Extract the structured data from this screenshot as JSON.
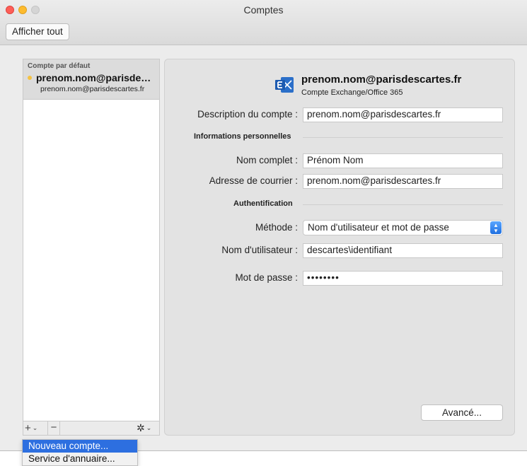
{
  "window": {
    "title": "Comptes",
    "show_all_label": "Afficher tout"
  },
  "sidebar": {
    "group_label": "Compte par défaut",
    "account_name": "prenom.nom@parisdesc...",
    "account_email": "prenom.nom@parisdescartes.fr",
    "status_color": "#f5c242",
    "toolbar": {
      "add_label": "+",
      "remove_label": "−",
      "gear_icon": "gear-icon"
    }
  },
  "account": {
    "title": "prenom.nom@parisdescartes.fr",
    "type": "Compte Exchange/Office 365",
    "icon": "exchange-icon"
  },
  "form": {
    "description_label": "Description du compte :",
    "description_value": "prenom.nom@parisdescartes.fr",
    "personal_section": "Informations personnelles",
    "fullname_label": "Nom complet :",
    "fullname_value": "Prénom Nom",
    "email_label": "Adresse de courrier :",
    "email_value": "prenom.nom@parisdescartes.fr",
    "auth_section": "Authentification",
    "method_label": "Méthode :",
    "method_value": "Nom d'utilisateur et mot de passe",
    "username_label": "Nom d'utilisateur :",
    "username_value": "descartes\\identifiant",
    "password_label": "Mot de passe :",
    "password_value": "••••••••",
    "advanced_label": "Avancé..."
  },
  "menu": {
    "items": [
      {
        "label": "Nouveau compte..."
      },
      {
        "label": "Service d'annuaire..."
      }
    ]
  }
}
